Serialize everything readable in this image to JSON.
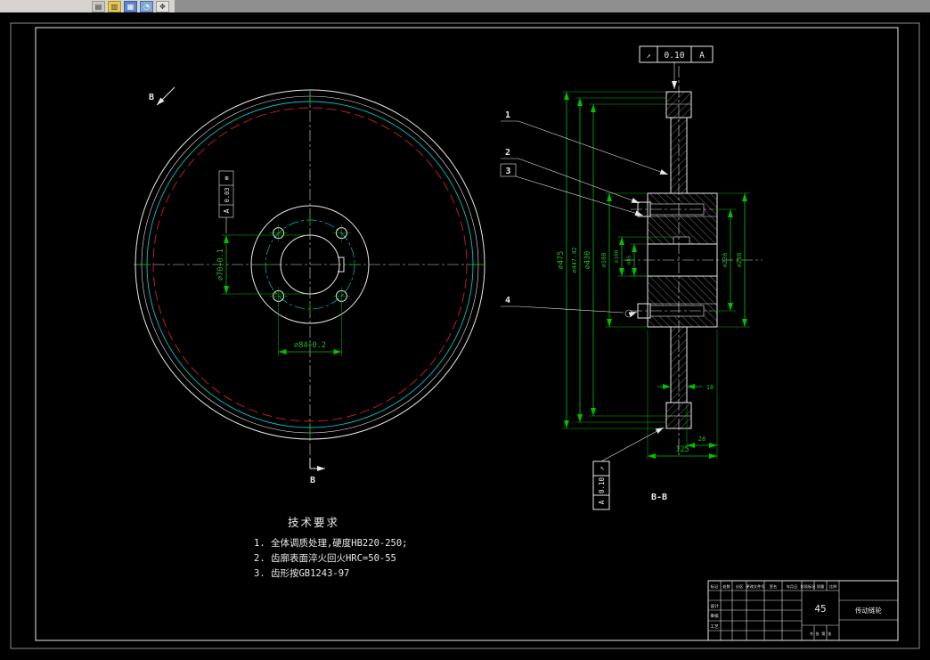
{
  "palette": {
    "canvas_bg": "#000000",
    "line_white": "#e8e8e8",
    "dimension_green": "#00bd00",
    "pitch_red": "#cc2222",
    "aux_cyan": "#00c3c3",
    "toolbar_gray": "#d7d4cf"
  },
  "toolbar": {
    "icons": [
      {
        "name": "open-icon",
        "glyph": "▤"
      },
      {
        "name": "save-icon",
        "glyph": "▥"
      },
      {
        "name": "print-icon",
        "glyph": "▦"
      },
      {
        "name": "zoom-icon",
        "glyph": "◔"
      },
      {
        "name": "pan-icon",
        "glyph": "✥"
      }
    ]
  },
  "front_view": {
    "section_arrow_top": "B",
    "section_arrow_bottom": "B",
    "dim_bore_vertical": "⌀70+0.1",
    "dim_bolt_bottom": "⌀84+0.2",
    "fcf": {
      "symbol": "≡",
      "value": "0.03",
      "datum": "A"
    }
  },
  "section_view": {
    "label": "B-B",
    "balloons": [
      "1",
      "2",
      "3",
      "4"
    ],
    "runout_top": {
      "symbol": "↗",
      "value": "0.10",
      "datum": "A"
    },
    "runout_bottom": {
      "symbol": "↗",
      "value": "0.10",
      "datum": "A"
    },
    "dims_left": [
      "⌀475",
      "⌀447.42",
      "⌀430",
      "⌀188",
      "⌀100",
      "⌀85"
    ],
    "dims_right": [
      "⌀236",
      "⌀286"
    ],
    "dim_width": "125",
    "dim_hub_step": "28",
    "dim_web_thickness": "18"
  },
  "tech_requirements": {
    "title": "技术要求",
    "items": [
      "1. 全体调质处理,硬度HB220-250;",
      "2. 齿廓表面淬火回火HRC=50-55",
      "3. 齿形按GB1243-97"
    ]
  },
  "title_block": {
    "material": "45",
    "part_name": "传动链轮",
    "header_labels": [
      "标记",
      "处数",
      "分区",
      "更改文件号",
      "签名",
      "年月日"
    ],
    "sign_labels": [
      "设计",
      "审核",
      "工艺"
    ],
    "stage_labels": [
      "阶段标记",
      "质量",
      "比例"
    ],
    "sheet_label": "共 张 第 张"
  }
}
